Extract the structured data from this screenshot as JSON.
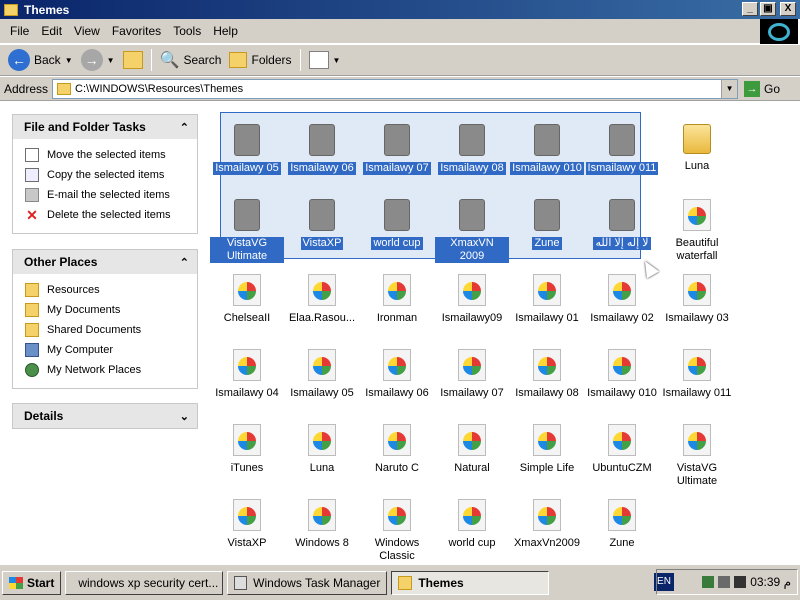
{
  "window": {
    "title": "Themes",
    "buttons": [
      "_",
      "▣",
      "X"
    ]
  },
  "menu": [
    "File",
    "Edit",
    "View",
    "Favorites",
    "Tools",
    "Help"
  ],
  "toolbar": {
    "back": "Back",
    "search": "Search",
    "folders": "Folders"
  },
  "address": {
    "label": "Address",
    "path": "C:\\WINDOWS\\Resources\\Themes",
    "go": "Go"
  },
  "file_tasks": {
    "title": "File and Folder Tasks",
    "items": [
      "Move the selected items",
      "Copy the selected items",
      "E-mail the selected items",
      "Delete the selected items"
    ]
  },
  "other_places": {
    "title": "Other Places",
    "items": [
      "Resources",
      "My Documents",
      "Shared Documents",
      "My Computer",
      "My Network Places"
    ]
  },
  "details": {
    "title": "Details"
  },
  "row1": [
    "Ismailawy 05",
    "Ismailawy 06",
    "Ismailawy 07",
    "Ismailawy 08",
    "Ismailawy 010",
    "Ismailawy 011",
    "Luna"
  ],
  "row2": [
    "VistaVG Ultimate",
    "VistaXP",
    "world cup",
    "XmaxVN 2009",
    "Zune",
    "لا إله إلا الله",
    "Beautiful waterfall"
  ],
  "row3": [
    "ChelseaII",
    "Elaa.Rasou...",
    "Ironman",
    "Ismailawy09",
    "Ismailawy 01",
    "Ismailawy 02",
    "Ismailawy 03"
  ],
  "row4": [
    "Ismailawy 04",
    "Ismailawy 05",
    "Ismailawy 06",
    "Ismailawy 07",
    "Ismailawy 08",
    "Ismailawy 010",
    "Ismailawy 011"
  ],
  "row5": [
    "iTunes",
    "Luna",
    "Naruto C",
    "Natural",
    "Simple Life",
    "UbuntuCZM",
    "VistaVG Ultimate"
  ],
  "row6": [
    "VistaXP",
    "Windows 8",
    "Windows Classic",
    "world cup",
    "XmaxVn2009",
    "Zune"
  ],
  "taskbar": {
    "start": "Start",
    "tasks": [
      "windows xp security cert...",
      "Windows Task Manager",
      "Themes"
    ],
    "lang": "EN",
    "clock": "03:39 م"
  }
}
